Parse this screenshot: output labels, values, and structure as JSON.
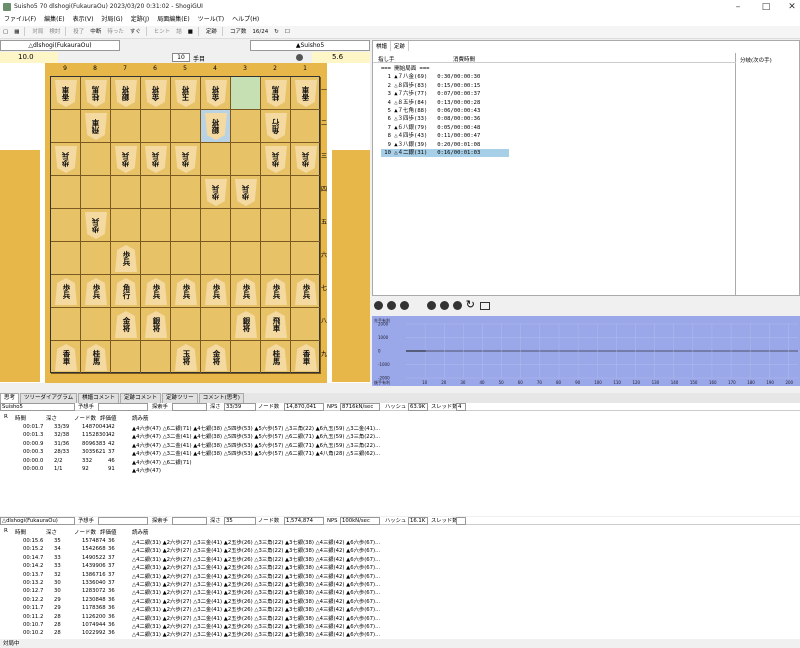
{
  "window": {
    "title": "Suisho5 70 dlshogi(FukauraOu) 2023/03/20 0:31:02 - ShogiGUI"
  },
  "menu": [
    "ファイル(F)",
    "編集(E)",
    "表示(V)",
    "対局(G)",
    "定跡(J)",
    "局面編集(E)",
    "ツール(T)",
    "ヘルプ(H)"
  ],
  "toolbar": {
    "items": [
      "対局",
      "検討",
      "投了",
      "中断",
      "待った",
      "すぐ",
      "ヒント",
      "詰",
      "定跡"
    ],
    "core_label": "コア数",
    "core_value": "16/24"
  },
  "players": {
    "gote": "△dlshogi(FukauraOu)",
    "sente": "▲Suisho5"
  },
  "clock": {
    "gote_time": "10.0",
    "sente_time": "5.6",
    "move_number": "10",
    "move_suffix": "手目"
  },
  "board": {
    "files": [
      "9",
      "8",
      "7",
      "6",
      "5",
      "4",
      "3",
      "2",
      "1"
    ],
    "ranks": [
      "一",
      "二",
      "三",
      "四",
      "五",
      "六",
      "七",
      "八",
      "九"
    ],
    "pieces": [
      {
        "f": 9,
        "r": 1,
        "t": "香車",
        "s": "g"
      },
      {
        "f": 8,
        "r": 1,
        "t": "桂馬",
        "s": "g"
      },
      {
        "f": 7,
        "r": 1,
        "t": "銀将",
        "s": "g"
      },
      {
        "f": 6,
        "r": 1,
        "t": "金将",
        "s": "g"
      },
      {
        "f": 5,
        "r": 1,
        "t": "玉将",
        "s": "g"
      },
      {
        "f": 4,
        "r": 1,
        "t": "金将",
        "s": "g"
      },
      {
        "f": 2,
        "r": 1,
        "t": "桂馬",
        "s": "g"
      },
      {
        "f": 1,
        "r": 1,
        "t": "香車",
        "s": "g"
      },
      {
        "f": 8,
        "r": 2,
        "t": "飛車",
        "s": "g"
      },
      {
        "f": 4,
        "r": 2,
        "t": "銀将",
        "s": "g"
      },
      {
        "f": 2,
        "r": 2,
        "t": "角行",
        "s": "g"
      },
      {
        "f": 9,
        "r": 3,
        "t": "歩兵",
        "s": "g"
      },
      {
        "f": 7,
        "r": 3,
        "t": "歩兵",
        "s": "g"
      },
      {
        "f": 6,
        "r": 3,
        "t": "歩兵",
        "s": "g"
      },
      {
        "f": 5,
        "r": 3,
        "t": "歩兵",
        "s": "g"
      },
      {
        "f": 2,
        "r": 3,
        "t": "歩兵",
        "s": "g"
      },
      {
        "f": 1,
        "r": 3,
        "t": "歩兵",
        "s": "g"
      },
      {
        "f": 4,
        "r": 4,
        "t": "歩兵",
        "s": "g"
      },
      {
        "f": 3,
        "r": 4,
        "t": "歩兵",
        "s": "g"
      },
      {
        "f": 8,
        "r": 5,
        "t": "歩兵",
        "s": "g"
      },
      {
        "f": 7,
        "r": 6,
        "t": "歩兵",
        "s": "s"
      },
      {
        "f": 9,
        "r": 7,
        "t": "歩兵",
        "s": "s"
      },
      {
        "f": 8,
        "r": 7,
        "t": "歩兵",
        "s": "s"
      },
      {
        "f": 7,
        "r": 7,
        "t": "角行",
        "s": "s"
      },
      {
        "f": 6,
        "r": 7,
        "t": "歩兵",
        "s": "s"
      },
      {
        "f": 5,
        "r": 7,
        "t": "歩兵",
        "s": "s"
      },
      {
        "f": 4,
        "r": 7,
        "t": "歩兵",
        "s": "s"
      },
      {
        "f": 3,
        "r": 7,
        "t": "歩兵",
        "s": "s"
      },
      {
        "f": 2,
        "r": 7,
        "t": "歩兵",
        "s": "s"
      },
      {
        "f": 1,
        "r": 7,
        "t": "歩兵",
        "s": "s"
      },
      {
        "f": 7,
        "r": 8,
        "t": "金将",
        "s": "s"
      },
      {
        "f": 6,
        "r": 8,
        "t": "銀将",
        "s": "s"
      },
      {
        "f": 3,
        "r": 8,
        "t": "銀将",
        "s": "s"
      },
      {
        "f": 2,
        "r": 8,
        "t": "飛車",
        "s": "s"
      },
      {
        "f": 9,
        "r": 9,
        "t": "香車",
        "s": "s"
      },
      {
        "f": 8,
        "r": 9,
        "t": "桂馬",
        "s": "s"
      },
      {
        "f": 5,
        "r": 9,
        "t": "玉将",
        "s": "s"
      },
      {
        "f": 4,
        "r": 9,
        "t": "金将",
        "s": "s"
      },
      {
        "f": 2,
        "r": 9,
        "t": "桂馬",
        "s": "s"
      },
      {
        "f": 1,
        "r": 9,
        "t": "香車",
        "s": "s"
      }
    ],
    "highlight": [
      {
        "f": 3,
        "r": 1
      },
      {
        "f": 4,
        "r": 2
      }
    ]
  },
  "kifu": {
    "tabs": [
      "棋譜",
      "定跡"
    ],
    "col_move": "指し手",
    "col_time": "消費時間",
    "col_branch": "分岐(次の手)",
    "moves": [
      "=== 開始局面 ===",
      "  1 ▲７八金(69)   0:30/00:00:30",
      "  2 △８四歩(83)   0:15/00:00:15",
      "  3 ▲７六歩(77)   0:07/00:00:37",
      "  4 △８五歩(84)   0:13/00:00:28",
      "  5 ▲７七角(88)   0:06/00:00:43",
      "  6 △３四歩(33)   0:08/00:00:36",
      "  7 ▲６八銀(79)   0:05/00:00:48",
      "  8 △４四歩(43)   0:11/00:00:47",
      "  9 ▲３八銀(39)   0:20/00:01:08",
      " 10 △４二銀(31)   0:16/00:01:03"
    ]
  },
  "graph": {
    "label_top": "先手有利",
    "label_bottom": "後手有利",
    "yticks": [
      "2000",
      "1000",
      "0",
      "-1000",
      "-2000"
    ],
    "xticks": [
      "10",
      "20",
      "30",
      "40",
      "50",
      "60",
      "70",
      "80",
      "90",
      "100",
      "110",
      "120",
      "130",
      "140",
      "150",
      "160",
      "170",
      "180",
      "190",
      "200"
    ]
  },
  "tabs2": [
    "思考",
    "ツリーダイアグラム",
    "棋譜コメント",
    "定跡コメント",
    "定跡ツリー",
    "コメント(思考)"
  ],
  "engine1": {
    "name": "Suisho5",
    "pred_label": "予想手",
    "search_label": "探索手",
    "depth_label": "深さ",
    "depth": "33/39",
    "nodes_label": "ノード数",
    "nodes": "14,870,041",
    "nps_label": "NPS",
    "nps": "8716kN/sec",
    "hash_label": "ハッシュ",
    "hash": "63.9K",
    "threads_label": "スレッド数",
    "threads": "4",
    "headers": [
      "R",
      "時間",
      "深さ",
      "ノード数",
      "評価値",
      "読み筋"
    ],
    "rows": [
      [
        "",
        "00:01.7",
        "33/39",
        "14870041",
        "42",
        "▲4六歩(47) △6二銀(71) ▲4七銀(38) △5四歩(53) ▲5六歩(57) △3三角(22) ▲6九玉(59) △3二金(41)..."
      ],
      [
        "",
        "00:01.3",
        "32/38",
        "11528301",
        "42",
        "▲4六歩(47) △3二金(41) ▲4七銀(38) △5四歩(53) ▲5六歩(57) △6二銀(71) ▲6九玉(59) △3三角(22)..."
      ],
      [
        "",
        "00:00.9",
        "31/36",
        "8096383",
        "42",
        "▲4六歩(47) △3二金(41) ▲4七銀(38) △5四歩(53) ▲5六歩(57) △6二銀(71) ▲6九玉(59) △3三角(22)..."
      ],
      [
        "",
        "00:00.3",
        "28/33",
        "3035621",
        "37",
        "▲4六歩(47) △3二金(41) ▲4七銀(38) △5四歩(53) ▲5六歩(57) △6二銀(71) ▲4八角(28) △5三銀(62)..."
      ],
      [
        "",
        "00:00.0",
        "2/2",
        "332",
        "46",
        "▲4六歩(47) △6二銀(71)"
      ],
      [
        "",
        "00:00.0",
        "1/1",
        "92",
        "91",
        "▲4六歩(47)"
      ]
    ]
  },
  "engine2": {
    "name": "△dlshogi(FukauraOu)",
    "pred_label": "予想手",
    "search_label": "探索手",
    "depth_label": "深さ",
    "depth": "35",
    "nodes_label": "ノード数",
    "nodes": "1,574,874",
    "nps_label": "NPS",
    "nps": "100kN/sec",
    "hash_label": "ハッシュ",
    "hash": "16.1K",
    "threads_label": "スレッド数",
    "threads": "",
    "headers": [
      "R",
      "時間",
      "深さ",
      "ノード数",
      "評価値",
      "読み筋"
    ],
    "rows": [
      [
        "",
        "00:15.6",
        "35",
        "1574874",
        "36",
        "△4二銀(31) ▲2六歩(27) △3三金(41) ▲2五歩(26) △3三角(22) ▲3七銀(38) △4三銀(42) ▲6六歩(67)..."
      ],
      [
        "",
        "00:15.2",
        "34",
        "1542668",
        "36",
        "△4二銀(31) ▲2六歩(27) △3三金(41) ▲2五歩(26) △3三角(22) ▲3七銀(38) △4三銀(42) ▲6六歩(67)..."
      ],
      [
        "",
        "00:14.7",
        "33",
        "1490522",
        "37",
        "△4二銀(31) ▲2六歩(27) △3二金(41) ▲2五歩(26) △3三角(22) ▲3七銀(38) △4三銀(42) ▲6六歩(67)..."
      ],
      [
        "",
        "00:14.2",
        "33",
        "1439906",
        "37",
        "△4二銀(31) ▲2六歩(27) △3二金(41) ▲2五歩(26) △3三角(22) ▲3七銀(38) △4三銀(42) ▲6六歩(67)..."
      ],
      [
        "",
        "00:13.7",
        "32",
        "1386716",
        "37",
        "△4二銀(31) ▲2六歩(27) △3二金(41) ▲2五歩(26) △3三角(22) ▲3七銀(38) △4三銀(42) ▲6六歩(67)..."
      ],
      [
        "",
        "00:13.2",
        "30",
        "1336040",
        "37",
        "△4二銀(31) ▲2六歩(27) △3二金(41) ▲2五歩(26) △3三角(22) ▲3七銀(38) △4三銀(42) ▲6六歩(67)..."
      ],
      [
        "",
        "00:12.7",
        "30",
        "1283072",
        "36",
        "△4二銀(31) ▲2六歩(27) △3二金(41) ▲2五歩(26) △3三角(22) ▲3七銀(38) △4三銀(42) ▲6六歩(67)..."
      ],
      [
        "",
        "00:12.2",
        "29",
        "1230848",
        "36",
        "△4二銀(31) ▲2六歩(27) △3二金(41) ▲2五歩(26) △3三角(22) ▲3七銀(38) △4三銀(42) ▲6六歩(67)..."
      ],
      [
        "",
        "00:11.7",
        "29",
        "1178368",
        "36",
        "△4二銀(31) ▲2六歩(27) △3二金(41) ▲2五歩(26) △3三角(22) ▲3七銀(38) △4三銀(42) ▲6六歩(67)..."
      ],
      [
        "",
        "00:11.2",
        "28",
        "1126200",
        "36",
        "△4二銀(31) ▲2六歩(27) △3二金(41) ▲2五歩(26) △3三角(22) ▲3七銀(38) △4三銀(42) ▲6六歩(67)..."
      ],
      [
        "",
        "00:10.7",
        "28",
        "1074944",
        "36",
        "△4二銀(31) ▲2六歩(27) △3二金(41) ▲2五歩(26) △3三角(22) ▲3七銀(38) △4三銀(42) ▲6六歩(67)..."
      ],
      [
        "",
        "00:10.2",
        "28",
        "1022992",
        "36",
        "△4二銀(31) ▲2六歩(27) △3二金(41) ▲2五歩(26) △3三角(22) ▲3七銀(38) △4三銀(42) ▲6六歩(67)..."
      ]
    ]
  },
  "status": "対局中"
}
